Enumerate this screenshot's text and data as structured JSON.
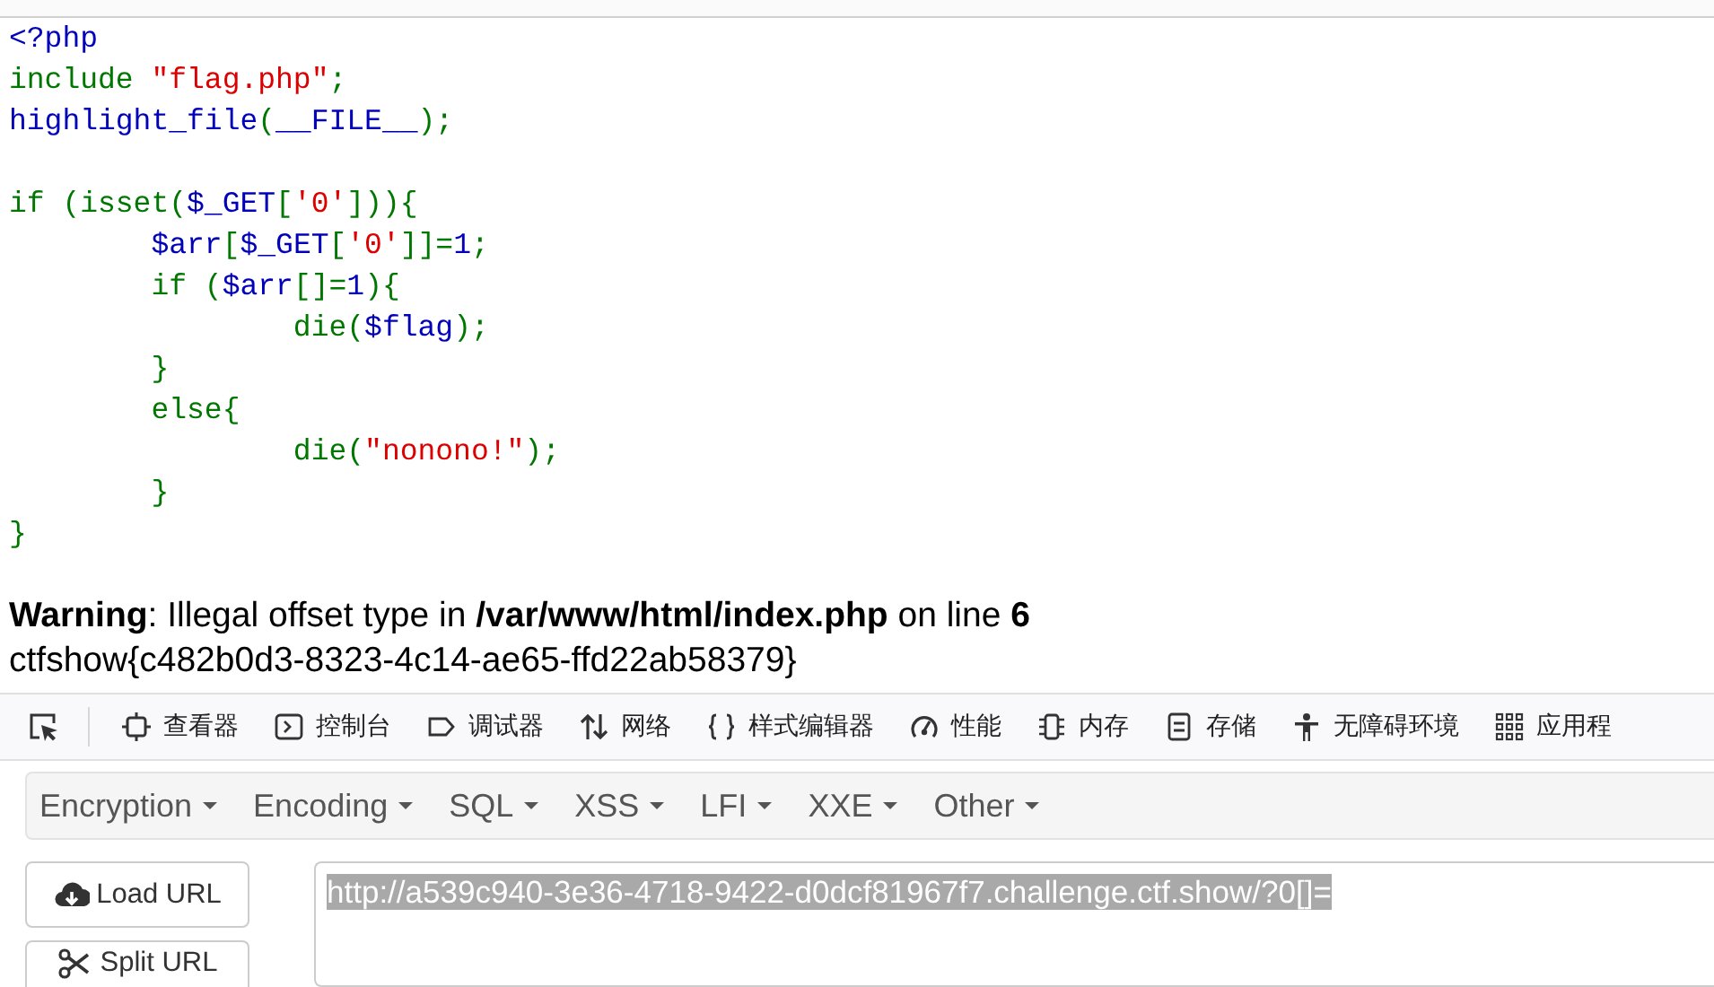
{
  "source_code": {
    "lines": [
      [
        {
          "kind": "default",
          "text": "<?php"
        }
      ],
      [
        {
          "kind": "keyword",
          "text": "include "
        },
        {
          "kind": "string",
          "text": "\"flag.php\""
        },
        {
          "kind": "keyword",
          "text": ";"
        }
      ],
      [
        {
          "kind": "default",
          "text": "highlight_file"
        },
        {
          "kind": "keyword",
          "text": "("
        },
        {
          "kind": "default",
          "text": "__FILE__"
        },
        {
          "kind": "keyword",
          "text": ");"
        }
      ],
      [
        {
          "kind": "blank"
        }
      ],
      [
        {
          "kind": "keyword",
          "text": "if (isset("
        },
        {
          "kind": "default",
          "text": "$_GET"
        },
        {
          "kind": "keyword",
          "text": "["
        },
        {
          "kind": "string",
          "text": "'0'"
        },
        {
          "kind": "keyword",
          "text": "])){"
        }
      ],
      [
        {
          "kind": "default",
          "text": "        $arr"
        },
        {
          "kind": "keyword",
          "text": "["
        },
        {
          "kind": "default",
          "text": "$_GET"
        },
        {
          "kind": "keyword",
          "text": "["
        },
        {
          "kind": "string",
          "text": "'0'"
        },
        {
          "kind": "keyword",
          "text": "]]="
        },
        {
          "kind": "default",
          "text": "1"
        },
        {
          "kind": "keyword",
          "text": ";"
        }
      ],
      [
        {
          "kind": "keyword",
          "text": "        if ("
        },
        {
          "kind": "default",
          "text": "$arr"
        },
        {
          "kind": "keyword",
          "text": "[]="
        },
        {
          "kind": "default",
          "text": "1"
        },
        {
          "kind": "keyword",
          "text": "){"
        }
      ],
      [
        {
          "kind": "keyword",
          "text": "                die("
        },
        {
          "kind": "default",
          "text": "$flag"
        },
        {
          "kind": "keyword",
          "text": ");"
        }
      ],
      [
        {
          "kind": "keyword",
          "text": "        }"
        }
      ],
      [
        {
          "kind": "keyword",
          "text": "        else{"
        }
      ],
      [
        {
          "kind": "keyword",
          "text": "                die("
        },
        {
          "kind": "string",
          "text": "\"nonono!\""
        },
        {
          "kind": "keyword",
          "text": ");"
        }
      ],
      [
        {
          "kind": "keyword",
          "text": "        }"
        }
      ],
      [
        {
          "kind": "keyword",
          "text": "}"
        }
      ]
    ]
  },
  "output": {
    "warning": "**Warning**: Illegal offset type in **/var/www/html/index.php** on line **6**",
    "flag": "ctfshow{c482b0d3-8323-4c14-ae65-ffd22ab58379}"
  },
  "devtools_tabs": [
    {
      "label": "查看器"
    },
    {
      "label": "控制台"
    },
    {
      "label": "调试器"
    },
    {
      "label": "网络"
    },
    {
      "label": "样式编辑器"
    },
    {
      "label": "性能"
    },
    {
      "label": "内存"
    },
    {
      "label": "存储"
    },
    {
      "label": "无障碍环境"
    },
    {
      "label": "应用程"
    }
  ],
  "hackbar": {
    "menus": [
      "Encryption",
      "Encoding",
      "SQL",
      "XSS",
      "LFI",
      "XXE",
      "Other"
    ],
    "buttons": [
      "Load URL",
      "Split URL"
    ],
    "url": {
      "value": "http://a539c940-3e36-4718-9422-d0dcf81967f7.challenge.ctf.show/?0[]=",
      "selected": true
    }
  }
}
